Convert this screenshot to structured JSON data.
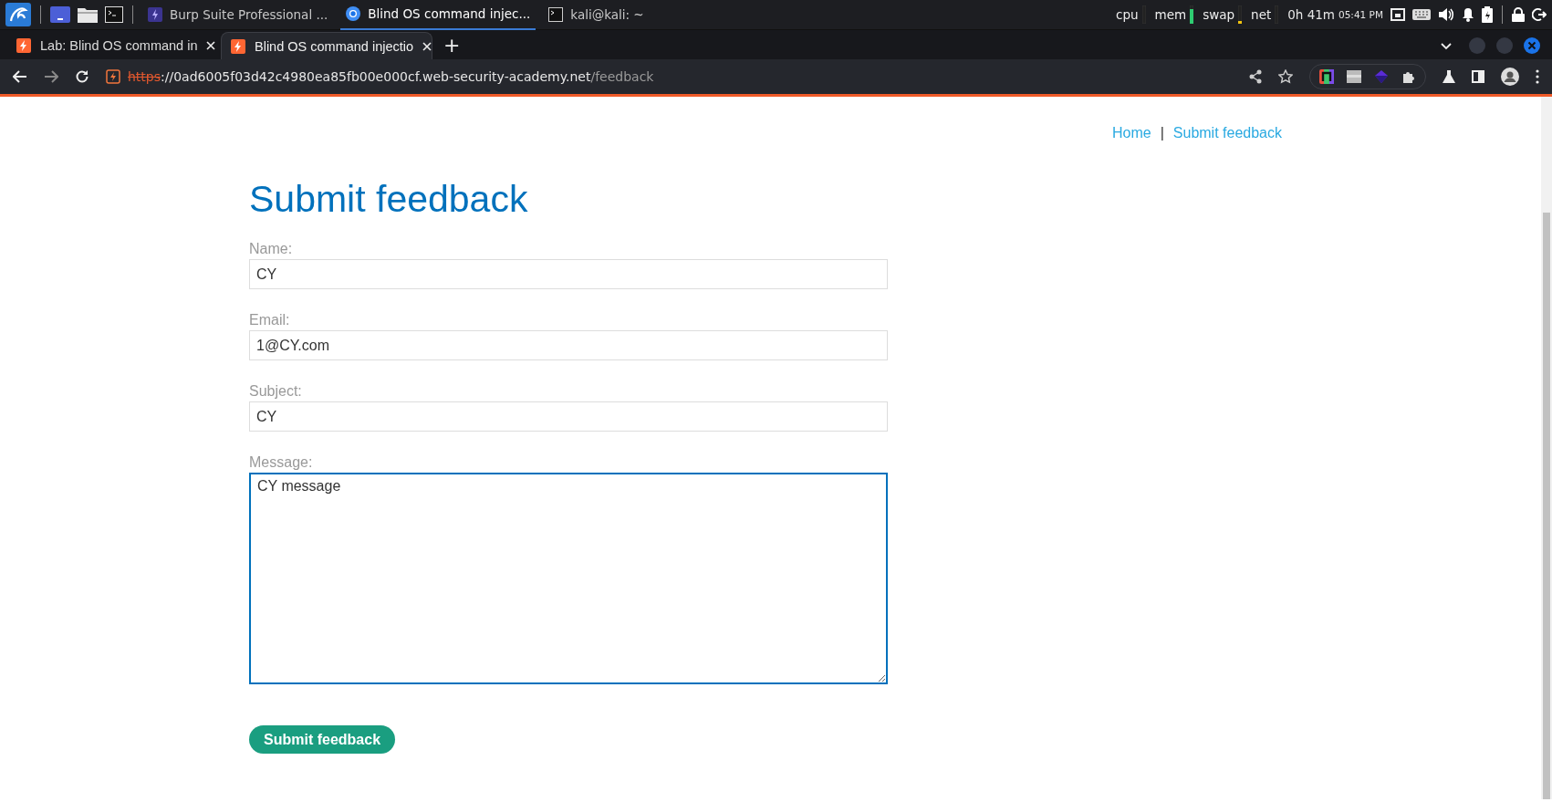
{
  "taskbar": {
    "windows": [
      {
        "title": "Burp Suite Professional ...",
        "selected": false
      },
      {
        "title": "Blind OS command injec...",
        "selected": true
      },
      {
        "title": "kali@kali: ~",
        "selected": false
      }
    ],
    "monitors": [
      "cpu",
      "mem",
      "swap",
      "net"
    ],
    "uptime": "0h 41m",
    "clock": "05:41 PM"
  },
  "browser": {
    "tabs": [
      {
        "title": "Lab: Blind OS command in",
        "selected": false
      },
      {
        "title": "Blind OS command injectio",
        "selected": true
      }
    ],
    "new_tab": "+",
    "url": {
      "scheme": "https",
      "host": "://0ad6005f03d42c4980ea85fb00e000cf.web-security-academy.net",
      "path": "/feedback"
    }
  },
  "page": {
    "nav": [
      "Home",
      "Submit feedback"
    ],
    "nav_separator": "|",
    "heading": "Submit feedback",
    "fields": [
      {
        "label": "Name:",
        "value": "CY",
        "kind": "input"
      },
      {
        "label": "Email:",
        "value": "1@CY.com",
        "kind": "input"
      },
      {
        "label": "Subject:",
        "value": "CY",
        "kind": "input"
      },
      {
        "label": "Message:",
        "value": "CY message",
        "kind": "textarea"
      }
    ],
    "submit": "Submit feedback"
  }
}
